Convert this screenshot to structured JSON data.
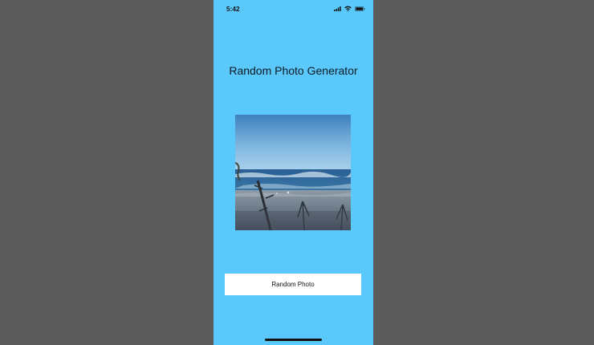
{
  "status_bar": {
    "time": "5:42",
    "icons": [
      "signal-icon",
      "wifi-icon",
      "battery-icon"
    ]
  },
  "app": {
    "title": "Random Photo Generator",
    "photo_description_icon": "beach-photo",
    "button_label": "Random Photo"
  },
  "colors": {
    "background": "#5b5b5b",
    "screen": "#5ac8fa",
    "button": "#ffffff"
  }
}
